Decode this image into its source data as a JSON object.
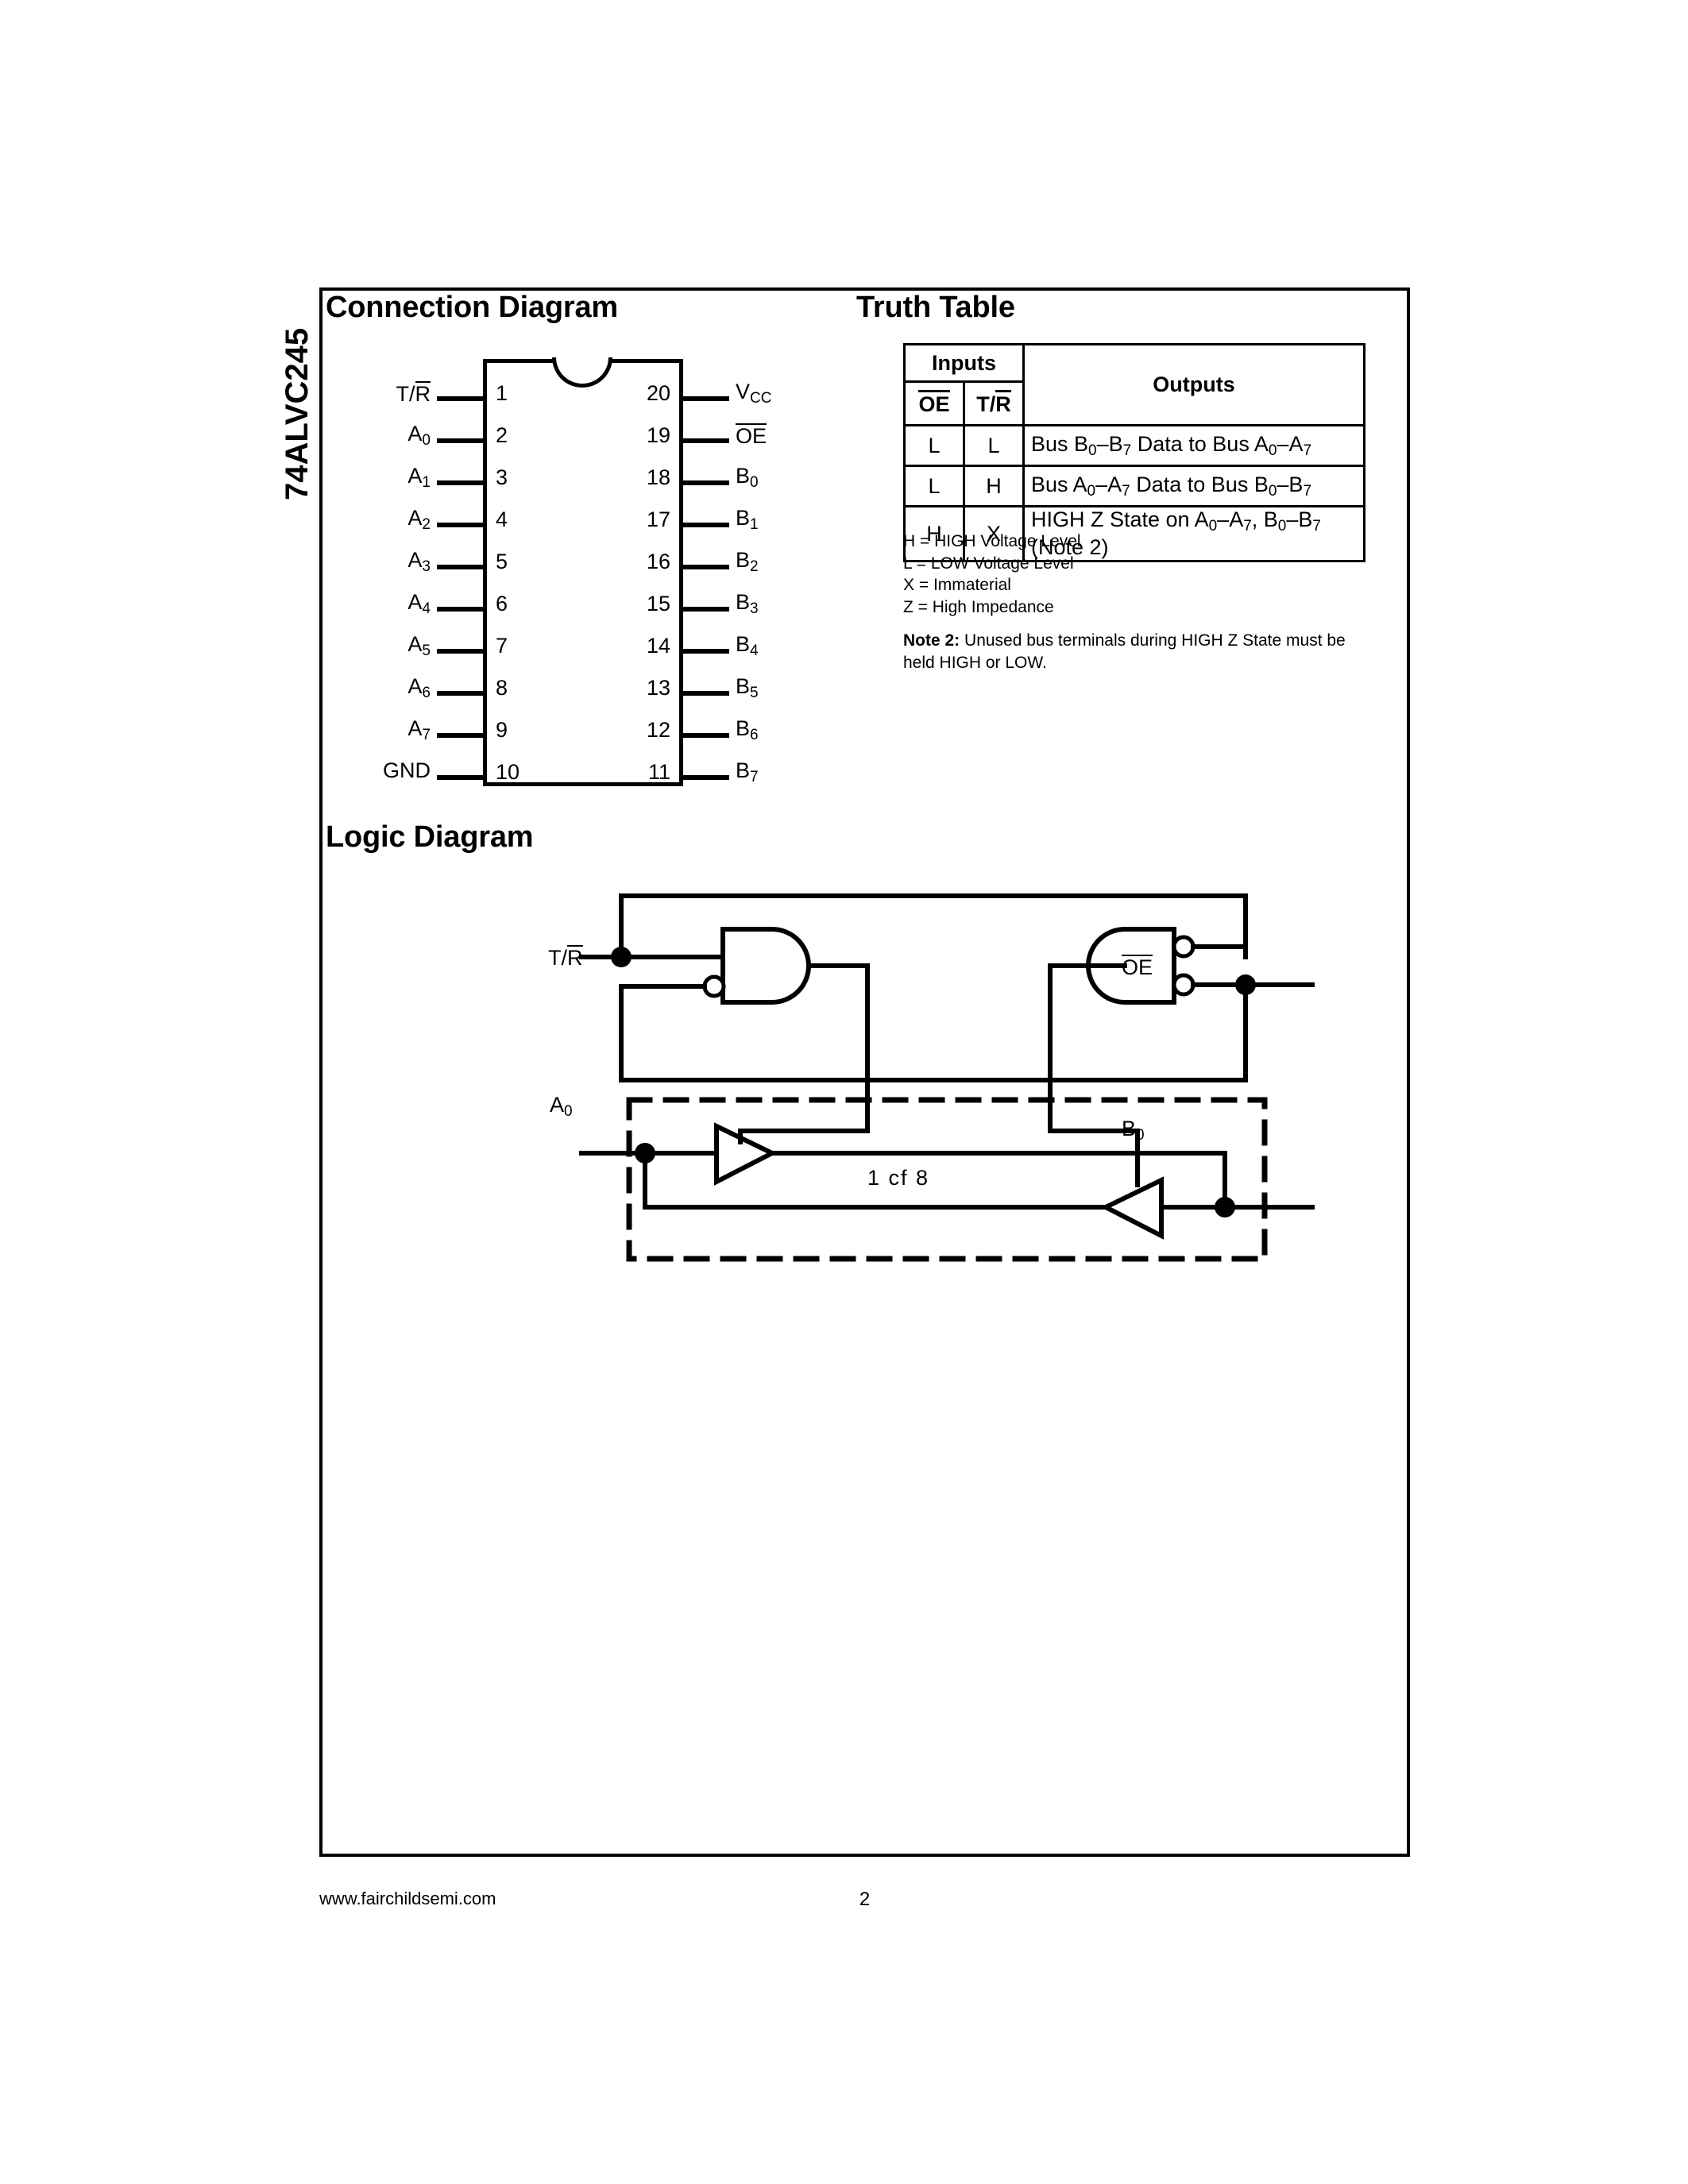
{
  "page": {
    "part_number": "74ALVC245",
    "footer_url": "www.fairchildsemi.com",
    "footer_page": "2"
  },
  "sections": {
    "connection_heading": "Connection Diagram",
    "truth_heading": "Truth Table",
    "logic_heading": "Logic Diagram"
  },
  "connection_diagram": {
    "left_pins": [
      {
        "num": "1",
        "label": "T/R",
        "overline": "R"
      },
      {
        "num": "2",
        "label": "A",
        "sub": "0"
      },
      {
        "num": "3",
        "label": "A",
        "sub": "1"
      },
      {
        "num": "4",
        "label": "A",
        "sub": "2"
      },
      {
        "num": "5",
        "label": "A",
        "sub": "3"
      },
      {
        "num": "6",
        "label": "A",
        "sub": "4"
      },
      {
        "num": "7",
        "label": "A",
        "sub": "5"
      },
      {
        "num": "8",
        "label": "A",
        "sub": "6"
      },
      {
        "num": "9",
        "label": "A",
        "sub": "7"
      },
      {
        "num": "10",
        "label": "GND"
      }
    ],
    "right_pins": [
      {
        "num": "20",
        "label": "V",
        "sub": "CC"
      },
      {
        "num": "19",
        "label": "OE",
        "overline": "OE"
      },
      {
        "num": "18",
        "label": "B",
        "sub": "0"
      },
      {
        "num": "17",
        "label": "B",
        "sub": "1"
      },
      {
        "num": "16",
        "label": "B",
        "sub": "2"
      },
      {
        "num": "15",
        "label": "B",
        "sub": "3"
      },
      {
        "num": "14",
        "label": "B",
        "sub": "4"
      },
      {
        "num": "13",
        "label": "B",
        "sub": "5"
      },
      {
        "num": "12",
        "label": "B",
        "sub": "6"
      },
      {
        "num": "11",
        "label": "B",
        "sub": "7"
      }
    ]
  },
  "truth_table": {
    "group_headers": [
      "Inputs",
      "Outputs"
    ],
    "input_columns": [
      "OE",
      "T/R"
    ],
    "rows": [
      {
        "oe": "L",
        "tr": "L",
        "output": "Bus B0–B7 Data to Bus A0–A7"
      },
      {
        "oe": "L",
        "tr": "H",
        "output": "Bus A0–A7 Data to Bus B0–B7"
      },
      {
        "oe": "H",
        "tr": "X",
        "output": "HIGH Z State on A0–A7, B0–B7 (Note 2)"
      }
    ],
    "legend": [
      "H = HIGH Voltage Level",
      "L = LOW Voltage Level",
      "X = Immaterial",
      "Z = High Impedance"
    ],
    "note_label": "Note 2:",
    "note_text": " Unused bus terminals during HIGH Z State must be held HIGH or LOW."
  },
  "logic_diagram": {
    "input_tr": "T/R",
    "output_oe": "OE",
    "bus_a": "A",
    "bus_a_sub": "0",
    "bus_b": "B",
    "bus_b_sub": "0",
    "group_caption": "1 cf 8"
  },
  "colors": {
    "ink": "#000000",
    "paper": "#ffffff"
  }
}
